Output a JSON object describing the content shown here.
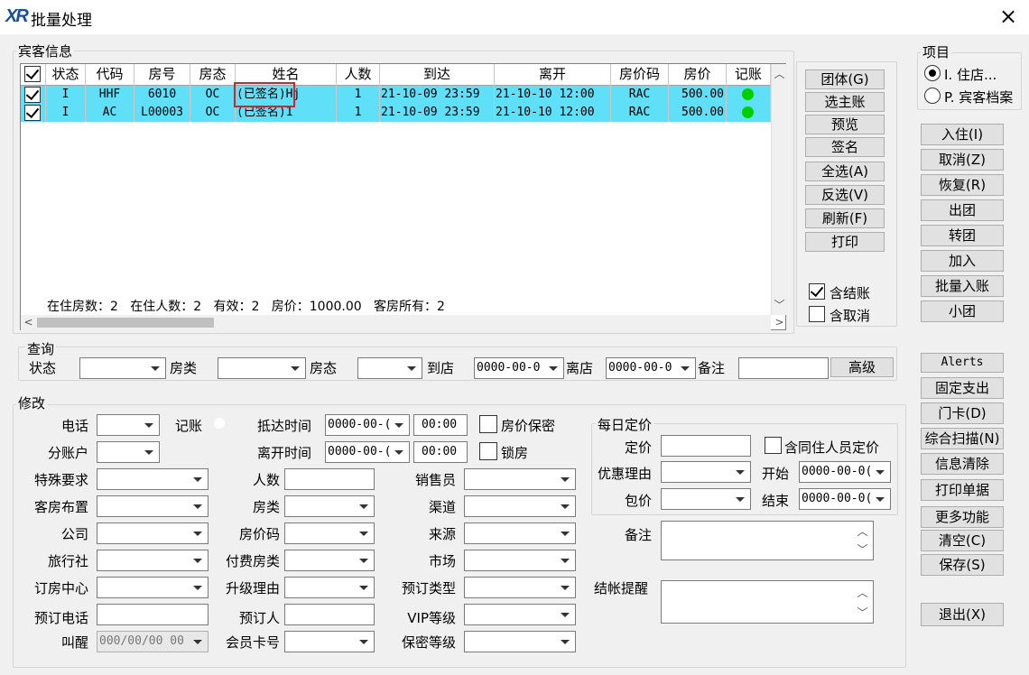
{
  "window": {
    "title": "批量处理",
    "logo": "XR",
    "close": "×"
  },
  "guest_info": {
    "group_label": "宾客信息",
    "columns": [
      "状态",
      "代码",
      "房号",
      "房态",
      "姓名",
      "人数",
      "到达",
      "离开",
      "房价码",
      "房价",
      "记账"
    ],
    "rows": [
      {
        "status": "I",
        "code": "HHF",
        "room": "6010",
        "room_status": "OC",
        "name": "(已签名)Hj",
        "persons": "1",
        "arrive": "21-10-09 23:59",
        "depart": "21-10-10 12:00",
        "rate_code": "RAC",
        "rate": "500.00"
      },
      {
        "status": "I",
        "code": "AC",
        "room": "L00003",
        "room_status": "OC",
        "name": "(已签名)1",
        "persons": "1",
        "arrive": "21-10-09 23:59",
        "depart": "21-10-10 12:00",
        "rate_code": "RAC",
        "rate": "500.00"
      }
    ],
    "summary": "在住房数：2   在住人数：2   有效：2   房价：1000.00   客房所有：2"
  },
  "side_buttons": [
    "团体(G)",
    "选主账",
    "预览",
    "签名",
    "全选(A)",
    "反选(V)",
    "刷新(F)",
    "打印"
  ],
  "checks": {
    "include_checkout": "含结账",
    "include_cancel": "含取消"
  },
  "item": {
    "label": "项目",
    "opt1": "I. 住店...",
    "opt2": "P. 宾客档案"
  },
  "right_buttons": [
    "入住(I)",
    "取消(Z)",
    "恢复(R)",
    "出团",
    "转团",
    "加入",
    "批量入账",
    "小团"
  ],
  "right_buttons2": [
    "Alerts",
    "固定支出",
    "门卡(D)",
    "综合扫描(N)",
    "信息清除",
    "打印单据",
    "更多功能",
    "清空(C)",
    "保存(S)"
  ],
  "exit_button": "退出(X)",
  "query": {
    "label": "查询",
    "status": "状态",
    "room_type": "房类",
    "room_status": "房态",
    "arrive": "到店",
    "arrive_val": "0000-00-0",
    "depart": "离店",
    "depart_val": "0000-00-0",
    "remark": "备注",
    "advanced": "高级"
  },
  "modify": {
    "label": "修改",
    "phone": "电话",
    "billing": "记账",
    "arrive_time": "抵达时间",
    "arrive_date": "0000-00-(",
    "arrive_hm": "00:00",
    "rate_secret": "房价保密",
    "sub_account": "分账户",
    "depart_time": "离开时间",
    "depart_date": "0000-00-(",
    "depart_hm": "00:00",
    "lock_room": "锁房",
    "special": "特殊要求",
    "persons": "人数",
    "salesman": "销售员",
    "room_layout": "客房布置",
    "room_type": "房类",
    "channel": "渠道",
    "company": "公司",
    "rate_code": "房价码",
    "source": "来源",
    "agency": "旅行社",
    "paid_room_type": "付费房类",
    "market": "市场",
    "booking_center": "订房中心",
    "upgrade_reason": "升级理由",
    "booking_type": "预订类型",
    "booking_phone": "预订电话",
    "booker": "预订人",
    "vip_level": "VIP等级",
    "wakeup": "叫醒",
    "wakeup_val": "000/00/00 00",
    "member_card": "会员卡号",
    "secret_level": "保密等级",
    "remark": "备注",
    "checkout_reminder": "结帐提醒"
  },
  "daily_rate": {
    "label": "每日定价",
    "set_price": "定价",
    "same_room": "含同住人员定价",
    "discount_reason": "优惠理由",
    "start": "开始",
    "start_val": "0000-00-0(",
    "package": "包价",
    "end": "结束",
    "end_val": "0000-00-0("
  }
}
